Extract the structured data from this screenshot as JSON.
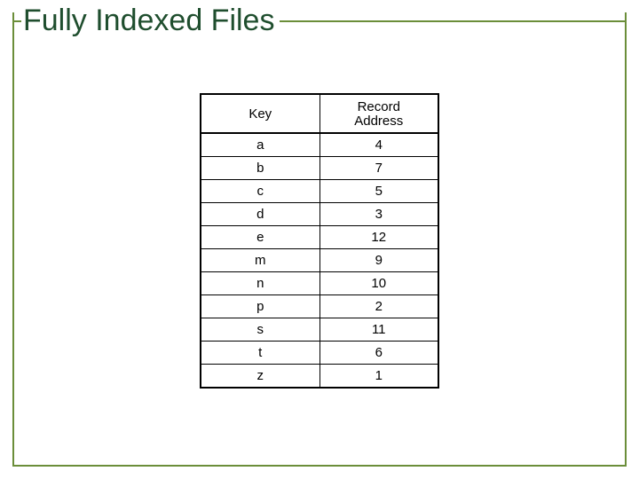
{
  "title": "Fully Indexed Files",
  "table": {
    "headers": {
      "key": "Key",
      "rec1": "Record",
      "rec2": "Address"
    },
    "rows": [
      {
        "key": "a",
        "addr": "4"
      },
      {
        "key": "b",
        "addr": "7"
      },
      {
        "key": "c",
        "addr": "5"
      },
      {
        "key": "d",
        "addr": "3"
      },
      {
        "key": "e",
        "addr": "12"
      },
      {
        "key": "m",
        "addr": "9"
      },
      {
        "key": "n",
        "addr": "10"
      },
      {
        "key": "p",
        "addr": "2"
      },
      {
        "key": "s",
        "addr": "11"
      },
      {
        "key": "t",
        "addr": "6"
      },
      {
        "key": "z",
        "addr": "1"
      }
    ]
  },
  "chart_data": {
    "type": "table",
    "title": "Fully Indexed Files",
    "columns": [
      "Key",
      "Record Address"
    ],
    "rows": [
      [
        "a",
        4
      ],
      [
        "b",
        7
      ],
      [
        "c",
        5
      ],
      [
        "d",
        3
      ],
      [
        "e",
        12
      ],
      [
        "m",
        9
      ],
      [
        "n",
        10
      ],
      [
        "p",
        2
      ],
      [
        "s",
        11
      ],
      [
        "t",
        6
      ],
      [
        "z",
        1
      ]
    ]
  }
}
